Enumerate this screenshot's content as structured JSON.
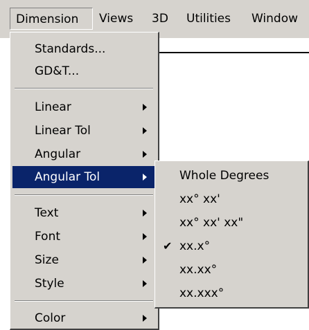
{
  "menubar": {
    "items": [
      {
        "label": "Dimension"
      },
      {
        "label": "Views"
      },
      {
        "label": "3D"
      },
      {
        "label": "Utilities"
      },
      {
        "label": "Window"
      }
    ]
  },
  "dimension_menu": {
    "items": [
      {
        "label": "Standards..."
      },
      {
        "label": "GD&T..."
      },
      {
        "label": "Linear"
      },
      {
        "label": "Linear Tol"
      },
      {
        "label": "Angular"
      },
      {
        "label": "Angular Tol"
      },
      {
        "label": "Text"
      },
      {
        "label": "Font"
      },
      {
        "label": "Size"
      },
      {
        "label": "Style"
      },
      {
        "label": "Color"
      }
    ]
  },
  "angular_tol_submenu": {
    "items": [
      {
        "label": "Whole Degrees"
      },
      {
        "label": "xx° xx'"
      },
      {
        "label": "xx° xx' xx\""
      },
      {
        "label": "xx.x°",
        "checked": true
      },
      {
        "label": "xx.xx°"
      },
      {
        "label": "xx.xxx°"
      }
    ],
    "check_glyph": "✔"
  },
  "colors": {
    "menu_bg": "#d6d3ce",
    "highlight_bg": "#0a246a",
    "highlight_text": "#ffffff"
  }
}
